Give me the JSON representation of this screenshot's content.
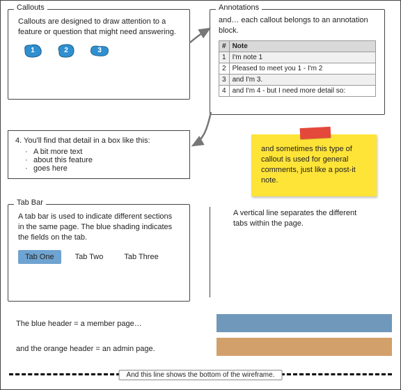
{
  "callouts": {
    "legend": "Callouts",
    "text": "Callouts are designed to draw attention to a feature or question that might need answering.",
    "numbers": [
      "1",
      "2",
      "3"
    ]
  },
  "annotations": {
    "legend": "Annotations",
    "text": "and… each callout belongs to an annotation block.",
    "headers": {
      "num": "#",
      "note": "Note"
    },
    "rows": [
      {
        "n": "1",
        "note": "I'm note 1"
      },
      {
        "n": "2",
        "note": "Pleased to meet you 1 - I'm 2"
      },
      {
        "n": "3",
        "note": "and I'm 3."
      },
      {
        "n": "4",
        "note": "and I'm 4 - but I need more detail so:"
      }
    ]
  },
  "detail": {
    "title": "4. You'll find that detail in a box like this:",
    "items": [
      "A bit more text",
      "about this feature",
      "goes here"
    ]
  },
  "sticky": {
    "text": "and sometimes this type of callout is used for general comments, just like a post-it note."
  },
  "tabbar": {
    "legend": "Tab Bar",
    "text": "A tab bar is used to indicate different sections in the same page. The blue shading indicates the fields on the tab.",
    "tabs": [
      "Tab One",
      "Tab Two",
      "Tab Three"
    ]
  },
  "vline_text": "A vertical line separates the different tabs within the page.",
  "headers": {
    "blue_label": "The blue header = a member page…",
    "orange_label": "and the orange header = an admin page."
  },
  "bottom_label": "And this line shows the bottom of the wireframe.",
  "colors": {
    "blob": "#2f8fd0",
    "tab_active": "#6fa3d1",
    "blue_bar": "#6f98bb",
    "orange_bar": "#d2a06a",
    "sticky": "#ffe438",
    "tape": "#e4483b"
  }
}
